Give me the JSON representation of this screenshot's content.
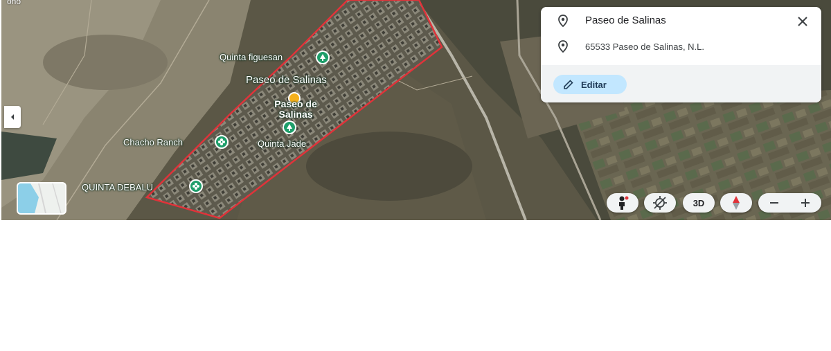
{
  "map": {
    "corner_text": "ono",
    "labels": {
      "quinta_figuesan": "Quinta figuesan",
      "paseo_area": "Paseo de Salinas",
      "paseo_pin_line1": "Paseo de",
      "paseo_pin_line2": "Salinas",
      "chacho_ranch": "Chacho Ranch",
      "quinta_jade": "Quinta Jade",
      "quinta_debalu": "QUINTA DEBALU"
    },
    "boundary_color": "#e0333a",
    "poi_color": "#1e9e6a",
    "selected_pin_color": "#f6b11c"
  },
  "place_card": {
    "title": "Paseo de Salinas",
    "address": "65533 Paseo de Salinas, N.L.",
    "edit_label": "Editar",
    "icons": [
      "place-pin-icon",
      "address-pin-icon",
      "close-icon",
      "pencil-icon"
    ]
  },
  "controls": {
    "pegman": "pegman-icon",
    "tilt": "tilt-icon",
    "three_d_label": "3D",
    "compass": "compass-icon",
    "zoom_out": "minus-icon",
    "zoom_in": "plus-icon"
  }
}
